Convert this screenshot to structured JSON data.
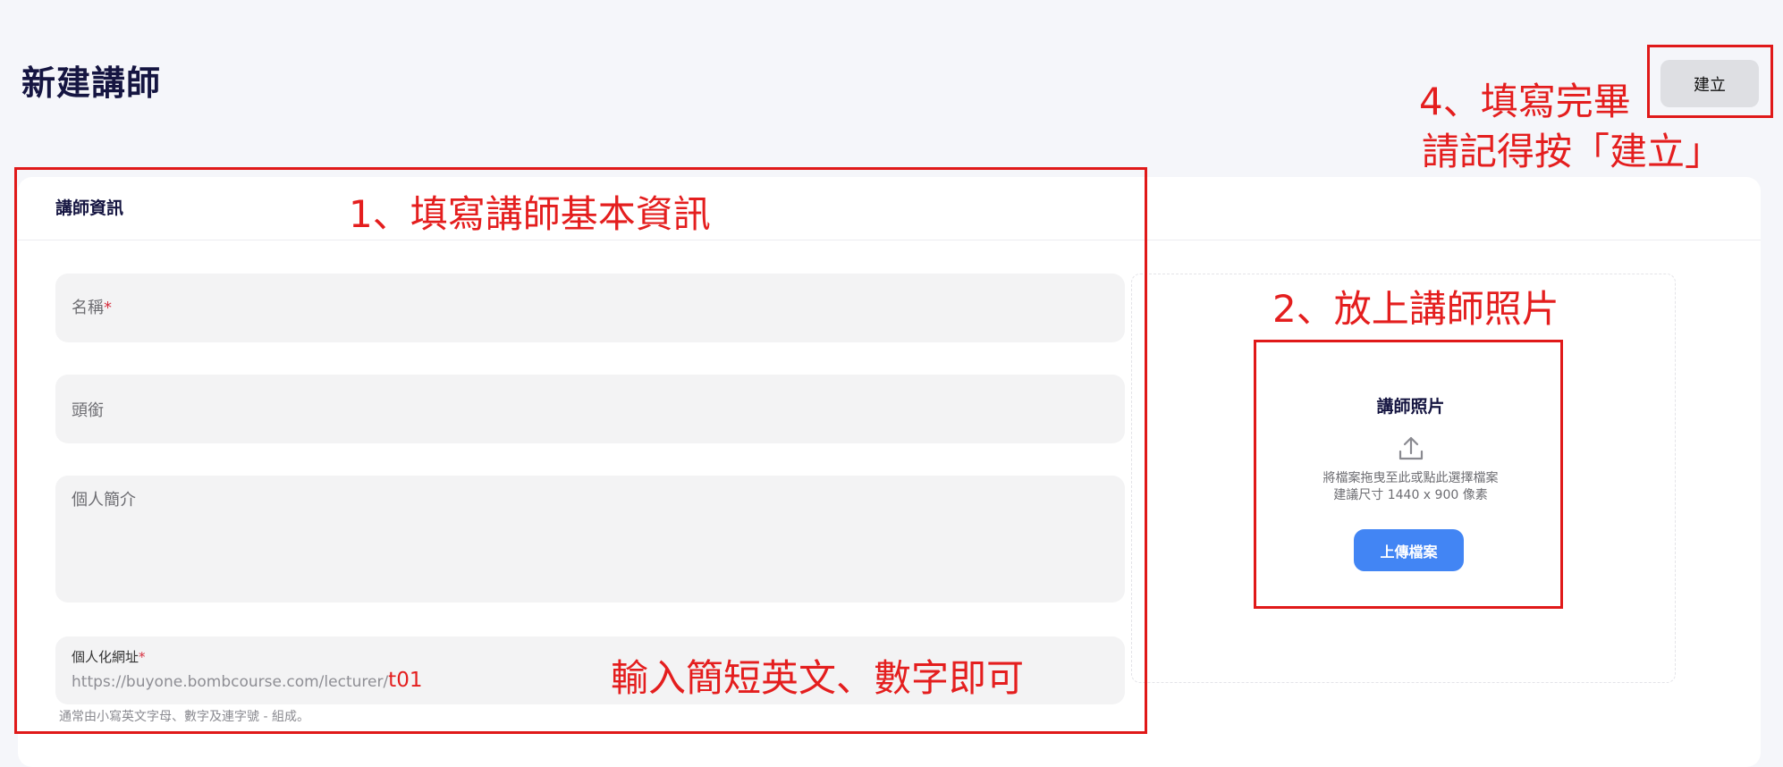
{
  "page": {
    "title": "新建講師"
  },
  "toolbar": {
    "create_label": "建立"
  },
  "lecturer_info": {
    "section_title": "講師資訊",
    "name_label": "名稱",
    "required_mark": "*",
    "title_label": "頭銜",
    "bio_label": "個人簡介",
    "url_label": "個人化網址",
    "url_prefix": "https://buyone.bombcourse.com/lecturer/",
    "url_value": "t01",
    "url_helper": "通常由小寫英文字母、數字及連字號 - 組成。"
  },
  "photo": {
    "title": "講師照片",
    "hint_line1": "將檔案拖曳至此或點此選擇檔案",
    "hint_line2": "建議尺寸 1440 x 900 像素",
    "upload_label": "上傳檔案",
    "icon": "upload-icon"
  },
  "annotations": {
    "step1": "1、填寫講師基本資訊",
    "step2": "2、放上講師照片",
    "step4_line1": "4、填寫完畢",
    "step4_line2": "請記得按「建立」",
    "url_tip": "輸入簡短英文、數字即可"
  },
  "colors": {
    "annotation_red": "#e01919",
    "primary_blue": "#4285f4",
    "background": "#f5f6fa"
  }
}
